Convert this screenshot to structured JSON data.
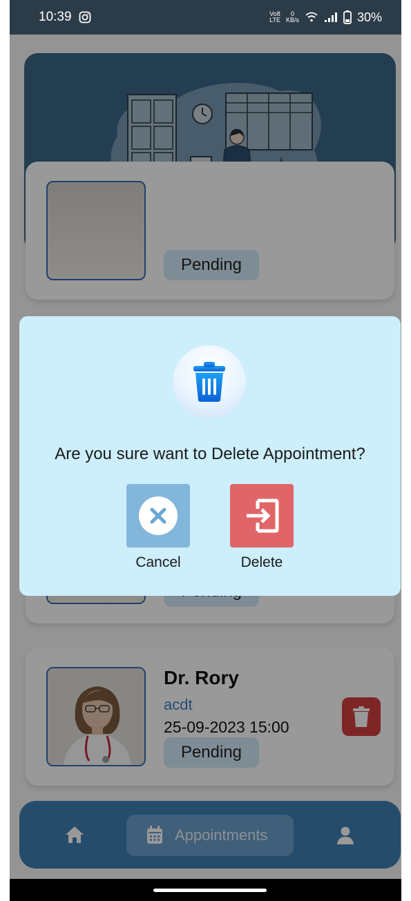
{
  "status_bar": {
    "time": "10:39",
    "net_top": "Vo8",
    "net_bottom": "LTE",
    "speed_value": "0",
    "speed_unit": "KB/s",
    "battery": "30%"
  },
  "cards": [
    {
      "pill": "Pending"
    },
    {
      "pill": "Pending"
    },
    {
      "name": "Dr. Rory",
      "specialty": "acdt",
      "datetime": "25-09-2023 15:00",
      "pill": "Pending"
    }
  ],
  "nav": {
    "appointments_label": "Appointments"
  },
  "dialog": {
    "message": "Are you sure want to Delete Appointment?",
    "cancel_label": "Cancel",
    "delete_label": "Delete"
  },
  "colors": {
    "accent": "#3f7fb2",
    "danger": "#d24040",
    "dialog_bg": "#cdeefb",
    "pill_bg": "#d2eaf8"
  }
}
